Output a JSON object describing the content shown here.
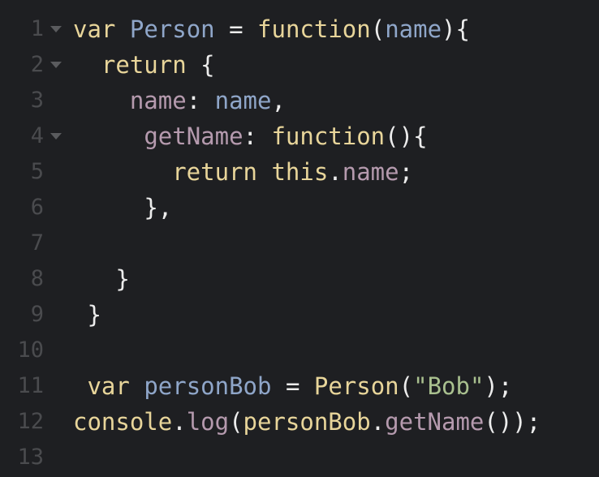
{
  "editor": {
    "lines": [
      {
        "number": "1",
        "fold": true,
        "indent": "",
        "tokens": [
          {
            "t": "kw",
            "v": "var"
          },
          {
            "t": "plain",
            "v": " "
          },
          {
            "t": "id",
            "v": "Person"
          },
          {
            "t": "plain",
            "v": " "
          },
          {
            "t": "punc",
            "v": "="
          },
          {
            "t": "plain",
            "v": " "
          },
          {
            "t": "fn",
            "v": "function"
          },
          {
            "t": "punc",
            "v": "("
          },
          {
            "t": "id",
            "v": "name"
          },
          {
            "t": "punc",
            "v": "){"
          }
        ]
      },
      {
        "number": "2",
        "fold": true,
        "indent": "  ",
        "tokens": [
          {
            "t": "kw",
            "v": "return"
          },
          {
            "t": "plain",
            "v": " "
          },
          {
            "t": "punc",
            "v": "{"
          }
        ]
      },
      {
        "number": "3",
        "fold": false,
        "indent": "    ",
        "tokens": [
          {
            "t": "prop",
            "v": "name"
          },
          {
            "t": "punc",
            "v": ":"
          },
          {
            "t": "plain",
            "v": " "
          },
          {
            "t": "id",
            "v": "name"
          },
          {
            "t": "punc",
            "v": ","
          }
        ]
      },
      {
        "number": "4",
        "fold": true,
        "indent": "     ",
        "tokens": [
          {
            "t": "prop",
            "v": "getName"
          },
          {
            "t": "punc",
            "v": ":"
          },
          {
            "t": "plain",
            "v": " "
          },
          {
            "t": "fn",
            "v": "function"
          },
          {
            "t": "punc",
            "v": "(){"
          }
        ]
      },
      {
        "number": "5",
        "fold": false,
        "indent": "       ",
        "tokens": [
          {
            "t": "kw",
            "v": "return"
          },
          {
            "t": "plain",
            "v": " "
          },
          {
            "t": "kw",
            "v": "this"
          },
          {
            "t": "punc",
            "v": "."
          },
          {
            "t": "prop",
            "v": "name"
          },
          {
            "t": "punc",
            "v": ";"
          }
        ]
      },
      {
        "number": "6",
        "fold": false,
        "indent": "     ",
        "tokens": [
          {
            "t": "punc",
            "v": "},"
          }
        ]
      },
      {
        "number": "7",
        "fold": false,
        "indent": "",
        "tokens": []
      },
      {
        "number": "8",
        "fold": false,
        "indent": "   ",
        "tokens": [
          {
            "t": "punc",
            "v": "}"
          }
        ]
      },
      {
        "number": "9",
        "fold": false,
        "indent": " ",
        "tokens": [
          {
            "t": "punc",
            "v": "}"
          }
        ]
      },
      {
        "number": "10",
        "fold": false,
        "indent": "",
        "tokens": []
      },
      {
        "number": "11",
        "fold": false,
        "indent": " ",
        "tokens": [
          {
            "t": "kw",
            "v": "var"
          },
          {
            "t": "plain",
            "v": " "
          },
          {
            "t": "id",
            "v": "personBob"
          },
          {
            "t": "plain",
            "v": " "
          },
          {
            "t": "punc",
            "v": "="
          },
          {
            "t": "plain",
            "v": " "
          },
          {
            "t": "fn",
            "v": "Person"
          },
          {
            "t": "punc",
            "v": "("
          },
          {
            "t": "str",
            "v": "\"Bob\""
          },
          {
            "t": "punc",
            "v": ");"
          }
        ]
      },
      {
        "number": "12",
        "fold": false,
        "indent": "",
        "tokens": [
          {
            "t": "fn",
            "v": "console"
          },
          {
            "t": "punc",
            "v": "."
          },
          {
            "t": "prop",
            "v": "log"
          },
          {
            "t": "punc",
            "v": "("
          },
          {
            "t": "fn",
            "v": "personBob"
          },
          {
            "t": "punc",
            "v": "."
          },
          {
            "t": "prop",
            "v": "getName"
          },
          {
            "t": "punc",
            "v": "());"
          }
        ]
      },
      {
        "number": "13",
        "fold": false,
        "indent": "",
        "tokens": []
      }
    ]
  },
  "icons": {
    "fold": "chevron-down-icon"
  },
  "colors": {
    "background": "#1e1f22",
    "line_number": "#4a4b4e",
    "keyword": "#e8d59a",
    "identifier": "#8fa6c9",
    "property": "#b59aae",
    "string": "#a9c08f",
    "punctuation": "#ececec"
  }
}
